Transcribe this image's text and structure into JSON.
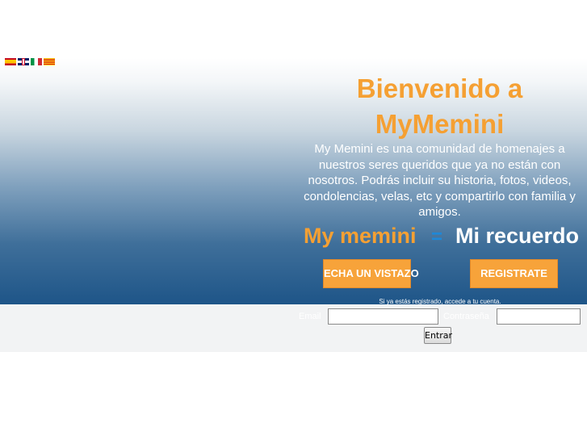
{
  "colors": {
    "accent_orange": "#f5a033",
    "button_orange": "#f7a33a",
    "equals_blue": "#1e88d8",
    "hero_dark_blue": "#1e5588"
  },
  "language_flags": [
    {
      "icon": "spain-flag-icon"
    },
    {
      "icon": "uk-flag-icon"
    },
    {
      "icon": "italy-flag-icon"
    },
    {
      "icon": "catalonia-flag-icon"
    }
  ],
  "hero": {
    "title_line1": "Bienvenido a",
    "title_line2": "MyMemini",
    "description": "My Memini es una comunidad de homenajes a nuestros seres queridos que ya no están con nosotros. Podrás incluir su historia, fotos, videos, condolencias, velas, etc y compartirlo con familia y amigos.",
    "motto_left": "My memini",
    "motto_equals": "=",
    "motto_right": "Mi recuerdo"
  },
  "buttons": {
    "vistazo": "ECHA UN VISTAZO",
    "registrate": "REGISTRATE"
  },
  "login": {
    "hint": "Si ya estás registrado, accede a tu cuenta.",
    "email_label": "Email",
    "email_value": "",
    "password_label": "Contraseña",
    "password_value": "",
    "submit": "Entrar"
  }
}
